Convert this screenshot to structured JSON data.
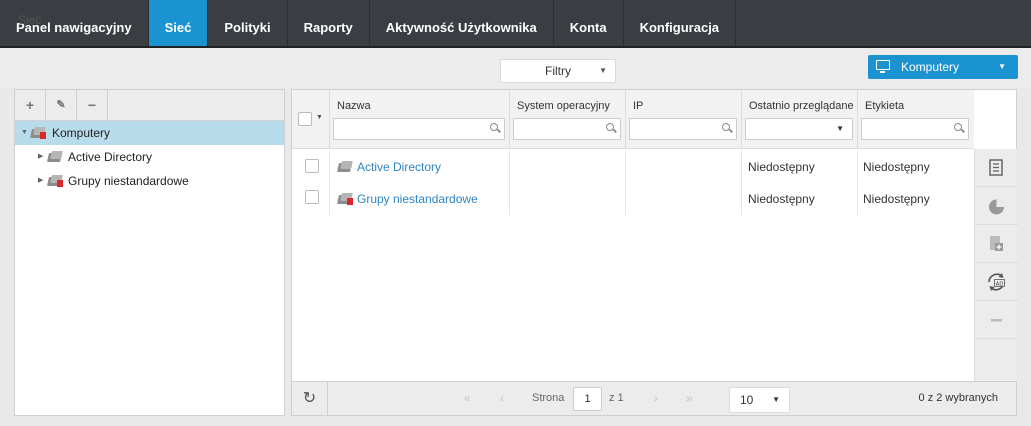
{
  "nav": {
    "tabs": [
      {
        "label": "Panel nawigacyjny",
        "active": false
      },
      {
        "label": "Sieć",
        "active": true
      },
      {
        "label": "Polityki",
        "active": false
      },
      {
        "label": "Raporty",
        "active": false
      },
      {
        "label": "Aktywność Użytkownika",
        "active": false
      },
      {
        "label": "Konta",
        "active": false
      },
      {
        "label": "Konfiguracja",
        "active": false
      }
    ],
    "accent": "#1c93d1"
  },
  "breadcrumb": "Sieć",
  "filters": {
    "label": "Filtry",
    "icon": "chevron-down-icon"
  },
  "computers_button": {
    "label": "Komputery",
    "icon": "monitor-icon"
  },
  "tree": {
    "toolbar": {
      "add": "+",
      "edit": "pencil-icon",
      "remove": "−"
    },
    "items": [
      {
        "label": "Komputery",
        "selected": true
      },
      {
        "label": "Active Directory",
        "selected": false
      },
      {
        "label": "Grupy niestandardowe",
        "selected": false
      }
    ]
  },
  "grid": {
    "columns": [
      "Nazwa",
      "System operacyjny",
      "IP",
      "Ostatnio przeglądane",
      "Etykieta"
    ],
    "rows": [
      {
        "name": "Active Directory",
        "os": "",
        "ip": "",
        "last_seen": "Niedostępny",
        "label": "Niedostępny"
      },
      {
        "name": "Grupy niestandardowe",
        "os": "",
        "ip": "",
        "last_seen": "Niedostępny",
        "label": "Niedostępny"
      }
    ],
    "side_actions": [
      "tasks-icon",
      "report-icon",
      "install-icon",
      "sync-ad-icon",
      "remove-icon"
    ],
    "footer": {
      "page_label": "Strona",
      "page": "1",
      "of_label": "z 1",
      "page_size": "10",
      "selection": "0 z 2 wybranych"
    }
  }
}
